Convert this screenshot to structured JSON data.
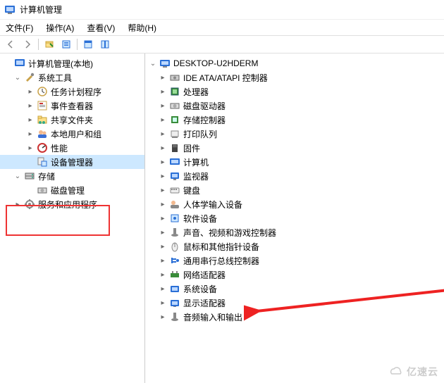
{
  "title": "计算机管理",
  "menu": {
    "file": "文件(F)",
    "action": "操作(A)",
    "view": "查看(V)",
    "help": "帮助(H)"
  },
  "left": {
    "root": "计算机管理(本地)",
    "system_tools": "系统工具",
    "task_scheduler": "任务计划程序",
    "event_viewer": "事件查看器",
    "shared_folders": "共享文件夹",
    "local_users": "本地用户和组",
    "performance": "性能",
    "device_manager": "设备管理器",
    "storage": "存储",
    "disk_mgmt": "磁盘管理",
    "services_apps": "服务和应用程序"
  },
  "right": {
    "computer": "DESKTOP-U2HDERM",
    "items": [
      "IDE ATA/ATAPI 控制器",
      "处理器",
      "磁盘驱动器",
      "存储控制器",
      "打印队列",
      "固件",
      "计算机",
      "监视器",
      "键盘",
      "人体学输入设备",
      "软件设备",
      "声音、视频和游戏控制器",
      "鼠标和其他指针设备",
      "通用串行总线控制器",
      "网络适配器",
      "系统设备",
      "显示适配器",
      "音频输入和输出"
    ]
  },
  "watermark": "亿速云"
}
